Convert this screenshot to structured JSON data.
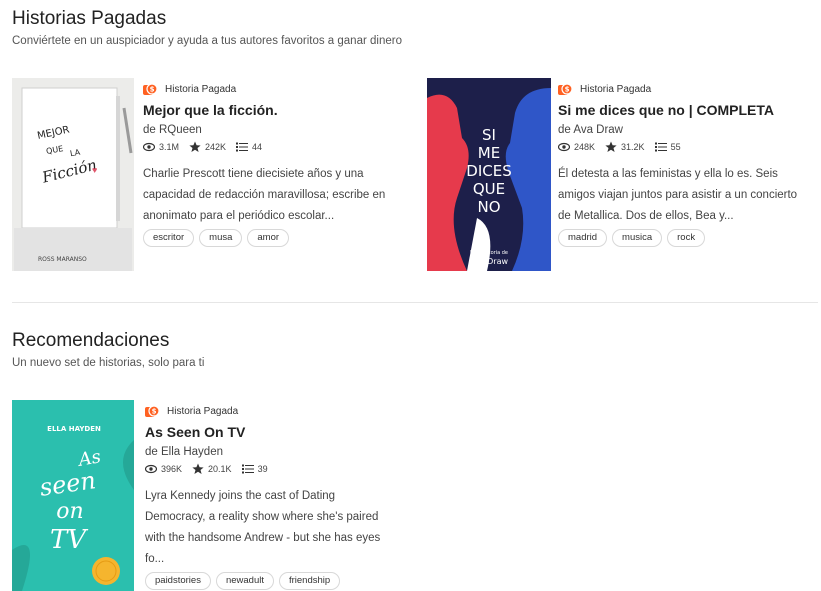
{
  "sections": [
    {
      "title": "Historias Pagadas",
      "subtitle": "Conviértete en un auspiciador y ayuda a tus autores favoritos a ganar dinero"
    },
    {
      "title": "Recomendaciones",
      "subtitle": "Un nuevo set de historias, solo para ti"
    }
  ],
  "stories": [
    {
      "badge": "Historia Pagada",
      "title": "Mejor que la ficción.",
      "author": "de RQueen",
      "reads": "3.1M",
      "votes": "242K",
      "parts": "44",
      "description": [
        "Charlie Prescott tiene diecisiete años y una",
        "capacidad de redacción maravillosa; escribe en",
        "anonimato para el periódico escolar..."
      ],
      "tags": [
        "escritor",
        "musa",
        "amor"
      ],
      "cover": {
        "line1": "MEJOR",
        "line2": "QUE",
        "line3": "LA",
        "line4": "Ficción",
        "author": "ROSS MARANSO",
        "bg": "#ececea"
      }
    },
    {
      "badge": "Historia Pagada",
      "title": "Si me dices que no | COMPLETA",
      "author": "de Ava Draw",
      "reads": "248K",
      "votes": "31.2K",
      "parts": "55",
      "description": [
        "Él detesta a las feministas y ella lo es. Seis",
        "amigos viajan juntos para asistir a un concierto",
        "de Metallica. Dos de ellos, Bea y..."
      ],
      "tags": [
        "madrid",
        "musica",
        "rock"
      ],
      "cover": {
        "line1": "SI",
        "line2": "ME",
        "line3": "DICES",
        "line4": "QUE",
        "line5": "NO",
        "line6": "Una historia de",
        "author": "Ava Draw",
        "bg": "#1d1f4a"
      }
    },
    {
      "badge": "Historia Pagada",
      "title": "As Seen On TV",
      "author": "de Ella Hayden",
      "reads": "396K",
      "votes": "20.1K",
      "parts": "39",
      "description": [
        "Lyra Kennedy joins the cast of Dating",
        "Democracy, a reality show where she's paired",
        "with the handsome Andrew - but she has eyes",
        "fo..."
      ],
      "tags": [
        "paidstories",
        "newadult",
        "friendship"
      ],
      "cover": {
        "author": "ELLA HAYDEN",
        "line1": "As",
        "line2": "seen",
        "line3": "on",
        "line4": "TV",
        "bg": "#2bbfae"
      }
    }
  ],
  "colors": {
    "accent": "#ff6122"
  },
  "icons": {
    "paid": "coin-icon",
    "reads": "eye-icon",
    "votes": "star-icon",
    "parts": "list-icon"
  }
}
